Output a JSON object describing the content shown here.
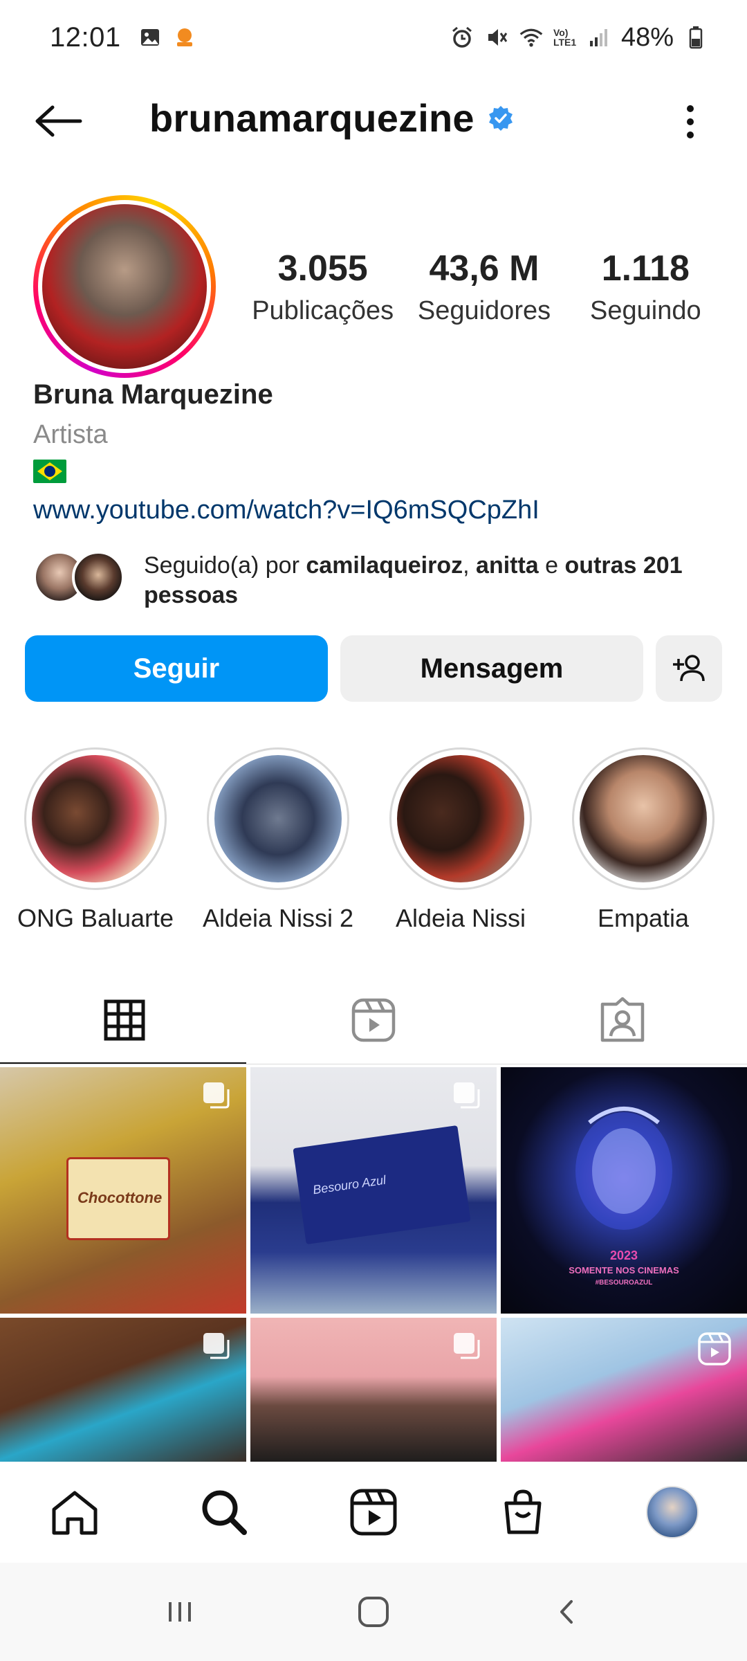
{
  "status_bar": {
    "time": "12:01",
    "network": "Vo) LTE1",
    "battery": "48%"
  },
  "header": {
    "username": "brunamarquezine",
    "verified": true
  },
  "profile": {
    "stats": [
      {
        "value": "3.055",
        "label": "Publicações"
      },
      {
        "value": "43,6 M",
        "label": "Seguidores"
      },
      {
        "value": "1.118",
        "label": "Seguindo"
      }
    ],
    "name": "Bruna Marquezine",
    "category": "Artista",
    "flag": "brazil-flag-icon",
    "link": "www.youtube.com/watch?v=IQ6mSQCpZhI",
    "followed_by": {
      "prefix": "Seguido(a) por ",
      "user1": "camilaqueiroz",
      "sep1": ", ",
      "user2": "anitta",
      "sep2": " e ",
      "others": "outras 201 pessoas"
    }
  },
  "actions": {
    "follow_label": "Seguir",
    "message_label": "Mensagem"
  },
  "highlights": [
    {
      "label": "ONG Baluarte"
    },
    {
      "label": "Aldeia Nissi 2"
    },
    {
      "label": "Aldeia Nissi"
    },
    {
      "label": "Empatia"
    }
  ],
  "posts": [
    {
      "type": "carousel",
      "caption": "Chocottone"
    },
    {
      "type": "carousel",
      "caption": "Besouro Azul"
    },
    {
      "type": "image",
      "caption_line1": "2023",
      "caption_line2": "SOMENTE NOS CINEMAS",
      "caption_line3": "#BESOUROAZUL"
    },
    {
      "type": "carousel"
    },
    {
      "type": "carousel"
    },
    {
      "type": "reel"
    }
  ],
  "colors": {
    "accent": "#0095f6",
    "link": "#00376b",
    "verified": "#3897f0"
  }
}
